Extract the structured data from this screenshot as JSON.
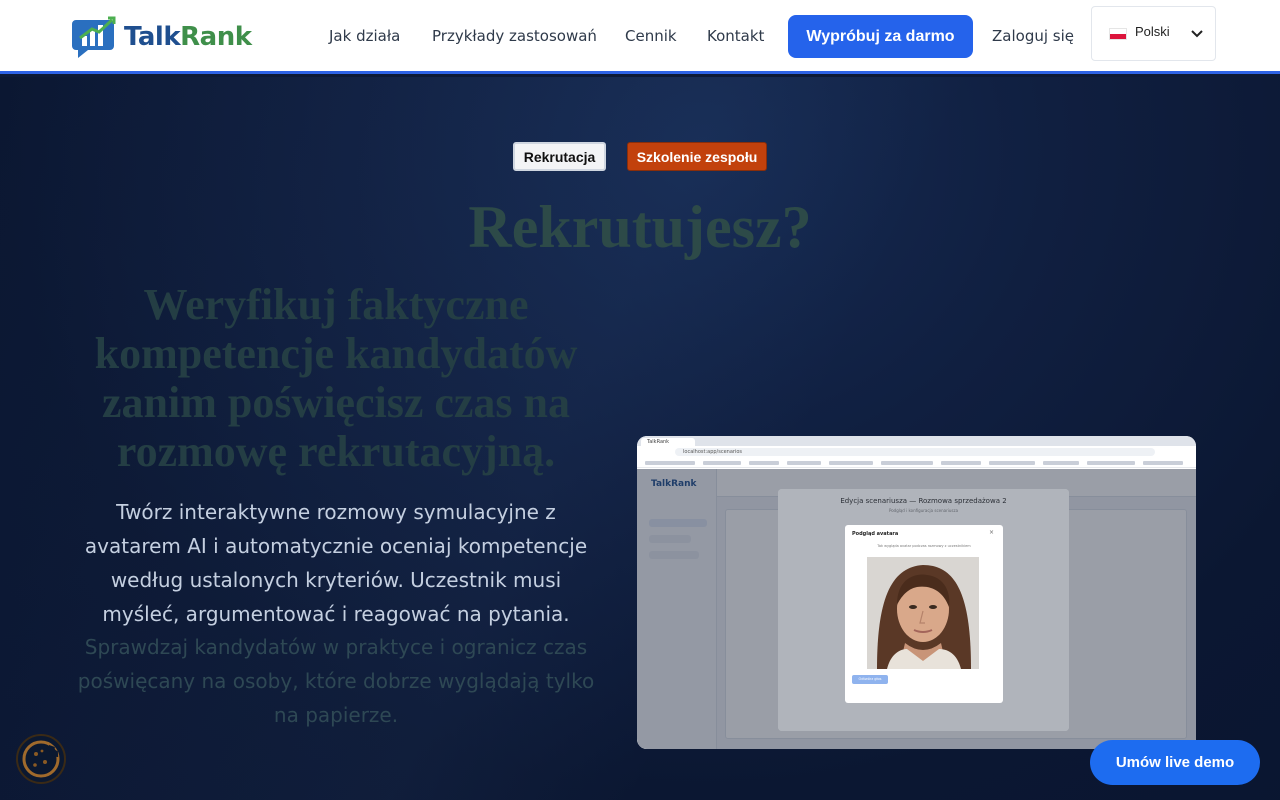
{
  "brand": {
    "name_part1": "Talk",
    "name_part2": "Rank",
    "colors": {
      "primary": "#2563eb",
      "accent_orange": "#c2410c",
      "logo_blue": "#1f4f8f",
      "logo_green": "#3f8f4a"
    }
  },
  "nav": {
    "items": [
      {
        "label": "Jak działa"
      },
      {
        "label": "Przykłady zastosowań"
      },
      {
        "label": "Cennik"
      },
      {
        "label": "Kontakt"
      }
    ],
    "cta_label": "Wypróbuj za darmo",
    "login_label": "Zaloguj się",
    "language": {
      "selected": "Polski",
      "flag_icon": "poland-flag-icon"
    }
  },
  "hero": {
    "tabs": [
      {
        "label": "Rekrutacja",
        "active": true
      },
      {
        "label": "Szkolenie zespołu",
        "active": false
      }
    ],
    "title": "Rekrutujesz?",
    "subtitle": "Weryfikuj faktyczne kompetencje kandydatów zanim poświęcisz czas na rozmowę rekrutacyjną.",
    "lead": "Twórz interaktywne rozmowy symulacyjne z avatarem AI i automatycznie oceniaj kompetencje według ustalonych kryteriów. Uczestnik musi myśleć, argumentować i reagować na pytania.",
    "lead_secondary": "Sprawdzaj kandydatów w praktyce i ogranicz czas poświęcany na osoby, które dobrze wyglądają tylko na papierze."
  },
  "preview": {
    "browser_tab": "TalkRank",
    "url": "localhost:app/scenarios",
    "app_logo": "TalkRank",
    "modal_title": "Edycja scenariusza — Rozmowa sprzedażowa 2",
    "modal_subtitle": "Podgląd i konfiguracja scenariusza",
    "avatar_dialog_title": "Podgląd avatara",
    "avatar_dialog_subtitle": "Tak wygląda avatar podczas rozmowy z uczestnikiem",
    "avatar_button": "Odtwórz głos"
  },
  "floating": {
    "demo_button": "Umów live demo",
    "cookie_icon": "cookie-icon"
  }
}
